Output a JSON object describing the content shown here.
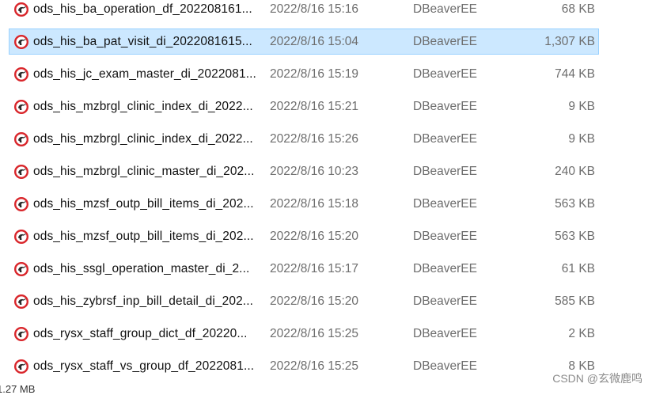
{
  "files": [
    {
      "name": "ods_his_ba_operation_df_202208161...",
      "date": "2022/8/16 15:16",
      "app": "DBeaverEE",
      "size": "68 KB",
      "icon": "dbeaver-icon",
      "selected": false
    },
    {
      "name": "ods_his_ba_pat_visit_di_2022081615...",
      "date": "2022/8/16 15:04",
      "app": "DBeaverEE",
      "size": "1,307 KB",
      "icon": "dbeaver-icon",
      "selected": true
    },
    {
      "name": "ods_his_jc_exam_master_di_2022081...",
      "date": "2022/8/16 15:19",
      "app": "DBeaverEE",
      "size": "744 KB",
      "icon": "dbeaver-icon",
      "selected": false
    },
    {
      "name": "ods_his_mzbrgl_clinic_index_di_2022...",
      "date": "2022/8/16 15:21",
      "app": "DBeaverEE",
      "size": "9 KB",
      "icon": "dbeaver-icon",
      "selected": false
    },
    {
      "name": "ods_his_mzbrgl_clinic_index_di_2022...",
      "date": "2022/8/16 15:26",
      "app": "DBeaverEE",
      "size": "9 KB",
      "icon": "dbeaver-icon",
      "selected": false
    },
    {
      "name": "ods_his_mzbrgl_clinic_master_di_202...",
      "date": "2022/8/16 10:23",
      "app": "DBeaverEE",
      "size": "240 KB",
      "icon": "dbeaver-icon",
      "selected": false
    },
    {
      "name": "ods_his_mzsf_outp_bill_items_di_202...",
      "date": "2022/8/16 15:18",
      "app": "DBeaverEE",
      "size": "563 KB",
      "icon": "dbeaver-icon",
      "selected": false
    },
    {
      "name": "ods_his_mzsf_outp_bill_items_di_202...",
      "date": "2022/8/16 15:20",
      "app": "DBeaverEE",
      "size": "563 KB",
      "icon": "dbeaver-icon",
      "selected": false
    },
    {
      "name": "ods_his_ssgl_operation_master_di_2...",
      "date": "2022/8/16 15:17",
      "app": "DBeaverEE",
      "size": "61 KB",
      "icon": "dbeaver-icon",
      "selected": false
    },
    {
      "name": "ods_his_zybrsf_inp_bill_detail_di_202...",
      "date": "2022/8/16 15:20",
      "app": "DBeaverEE",
      "size": "585 KB",
      "icon": "dbeaver-icon",
      "selected": false
    },
    {
      "name": "ods_rysx_staff_group_dict_df_20220...",
      "date": "2022/8/16 15:25",
      "app": "DBeaverEE",
      "size": "2 KB",
      "icon": "dbeaver-icon",
      "selected": false
    },
    {
      "name": "ods_rysx_staff_vs_group_df_2022081...",
      "date": "2022/8/16 15:25",
      "app": "DBeaverEE",
      "size": "8 KB",
      "icon": "dbeaver-icon",
      "selected": false
    }
  ],
  "status_bar": {
    "text": "1.27 MB"
  },
  "watermark": {
    "text": "CSDN @玄微鹿鸣"
  },
  "colors": {
    "selection_bg": "#cce8ff",
    "selection_border": "#99d1ff",
    "icon_red": "#d9262b"
  }
}
